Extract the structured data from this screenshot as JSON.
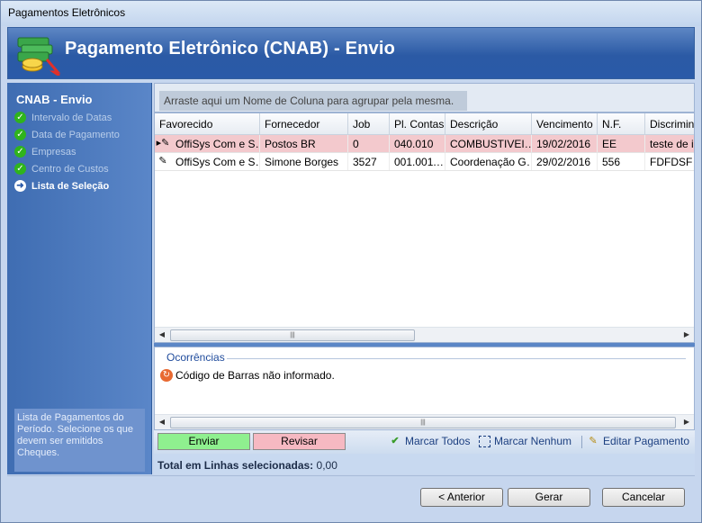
{
  "window": {
    "title": "Pagamentos Eletrônicos"
  },
  "banner": {
    "title": "Pagamento Eletrônico (CNAB) - Envio",
    "logo_icon": "money-stack-icon"
  },
  "sidebar": {
    "title": "CNAB - Envio",
    "steps": [
      {
        "label": "Intervalo de Datas",
        "icon": "check-icon"
      },
      {
        "label": "Data de Pagamento",
        "icon": "check-icon"
      },
      {
        "label": "Empresas",
        "icon": "check-icon"
      },
      {
        "label": "Centro de Custos",
        "icon": "check-icon"
      },
      {
        "label": "Lista de Seleção",
        "icon": "arrow-right-icon"
      }
    ],
    "help": "Lista de Pagamentos do Período. Selecione os que devem ser emitidos Cheques."
  },
  "grid": {
    "group_hint": "Arraste aqui um Nome de Coluna para agrupar pela mesma.",
    "columns": [
      "Favorecido",
      "Fornecedor",
      "Job",
      "Pl. Contas",
      "Descrição",
      "Vencimento",
      "N.F.",
      "Discrimina"
    ],
    "rows": [
      {
        "cells": [
          "OffiSys Com e S…",
          "Postos BR",
          "0",
          "040.010",
          "COMBUSTIVEI…",
          "19/02/2016",
          "EE",
          "teste de i"
        ],
        "selected": true
      },
      {
        "cells": [
          "OffiSys Com e S…",
          "Simone Borges",
          "3527",
          "001.001.…",
          "Coordenação G…",
          "29/02/2016",
          "556",
          "FDFDSF"
        ],
        "selected": false
      }
    ]
  },
  "occurrences": {
    "title": "Ocorrências",
    "items": [
      "Código de Barras não informado."
    ]
  },
  "actions": {
    "send": "Enviar",
    "review": "Revisar",
    "mark_all": "Marcar Todos",
    "mark_none": "Marcar Nenhum",
    "edit_payment": "Editar Pagamento"
  },
  "totals": {
    "label": "Total em Linhas selecionadas:",
    "value": "0,00"
  },
  "footer": {
    "back": "< Anterior",
    "generate": "Gerar",
    "cancel": "Cancelar"
  },
  "colors": {
    "banner": "#2a5aa8",
    "selected_row": "#f3c9cd",
    "send": "#8ff08f",
    "review": "#f6b9c2"
  }
}
